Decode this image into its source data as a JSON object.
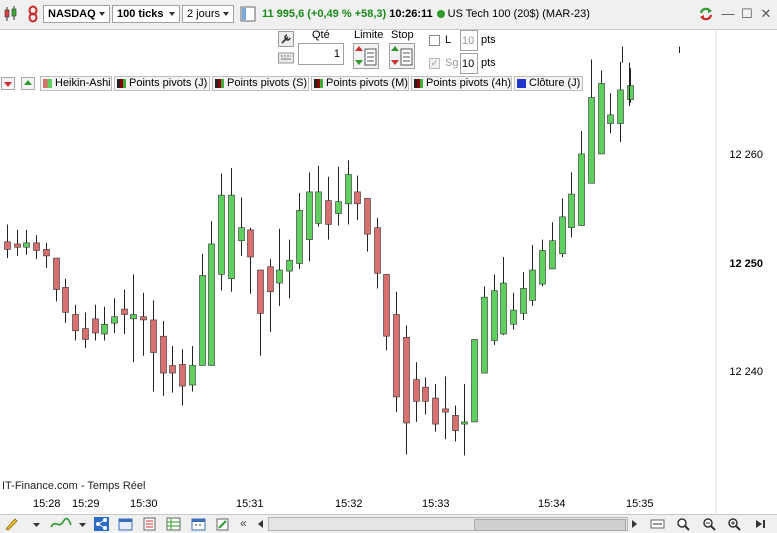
{
  "toolbar": {
    "instrument": "NASDAQ",
    "ticks": "100 ticks",
    "period": "2 jours",
    "price": "11 995,6",
    "change": "(+0,49 % +58,3)",
    "time": "10:26:11",
    "contract": "US Tech 100 (20$) (MAR-23)"
  },
  "order": {
    "qty_label": "Qté",
    "qty_value": "1",
    "limit_label": "Limite",
    "stop_label": "Stop",
    "l_label": "L",
    "sg_label": "Sg",
    "pts1_value": "10",
    "pts1_label": "pts",
    "pts2_value": "10",
    "pts2_label": "pts"
  },
  "indicators": [
    {
      "label": "Heikin-Ashi",
      "color": "#c0504d"
    },
    {
      "label": "Points pivots (J)",
      "color": "#8b0000"
    },
    {
      "label": "Points pivots (S)",
      "color": "#8b0000"
    },
    {
      "label": "Points pivots (M)",
      "color": "#8b0000"
    },
    {
      "label": "Points pivots (4h)",
      "color": "#8b0000"
    },
    {
      "label": "Clôture (J)",
      "color": "#2233cc"
    }
  ],
  "price_axis": {
    "p12260": "12 260",
    "p12250": "12 250",
    "p12240": "12 240"
  },
  "time_axis": {
    "t1": "15:28",
    "t2": "15:29",
    "t3": "15:30",
    "t4": "15:31",
    "t5": "15:32",
    "t6": "15:33",
    "t7": "15:34",
    "t8": "15:35"
  },
  "watermark": "IT-Finance.com - Temps Réel",
  "colors": {
    "up": "#5fcf5f",
    "down": "#d97070",
    "wick": "#222222"
  },
  "chart_data": {
    "type": "candlestick",
    "ylim": [
      12232,
      12270
    ],
    "candles": [
      {
        "o": 12252.0,
        "c": 12251.3,
        "h": 12253.6,
        "l": 12250.5
      },
      {
        "o": 12251.8,
        "c": 12251.5,
        "h": 12253.1,
        "l": 12250.7
      },
      {
        "o": 12251.5,
        "c": 12251.9,
        "h": 12253.1,
        "l": 12250.8
      },
      {
        "o": 12251.9,
        "c": 12251.2,
        "h": 12252.6,
        "l": 12250.4
      },
      {
        "o": 12251.3,
        "c": 12250.7,
        "h": 12251.9,
        "l": 12249.6
      },
      {
        "o": 12250.5,
        "c": 12247.6,
        "h": 12250.5,
        "l": 12246.5
      },
      {
        "o": 12247.8,
        "c": 12245.5,
        "h": 12248.6,
        "l": 12244.5
      },
      {
        "o": 12245.3,
        "c": 12243.8,
        "h": 12246.2,
        "l": 12242.9
      },
      {
        "o": 12244.0,
        "c": 12243.0,
        "h": 12245.5,
        "l": 12242.2
      },
      {
        "o": 12244.9,
        "c": 12243.6,
        "h": 12246.2,
        "l": 12242.9
      },
      {
        "o": 12243.5,
        "c": 12244.4,
        "h": 12246.0,
        "l": 12242.9
      },
      {
        "o": 12244.5,
        "c": 12245.1,
        "h": 12246.8,
        "l": 12243.6
      },
      {
        "o": 12245.8,
        "c": 12245.3,
        "h": 12247.6,
        "l": 12243.5
      },
      {
        "o": 12244.9,
        "c": 12245.3,
        "h": 12249.0,
        "l": 12240.9
      },
      {
        "o": 12245.1,
        "c": 12244.8,
        "h": 12247.3,
        "l": 12241.5
      },
      {
        "o": 12244.8,
        "c": 12241.8,
        "h": 12246.6,
        "l": 12238.2
      },
      {
        "o": 12243.3,
        "c": 12239.9,
        "h": 12244.7,
        "l": 12237.8
      },
      {
        "o": 12240.6,
        "c": 12239.9,
        "h": 12242.4,
        "l": 12238.1
      },
      {
        "o": 12240.7,
        "c": 12238.7,
        "h": 12242.1,
        "l": 12236.9
      },
      {
        "o": 12238.8,
        "c": 12240.6,
        "h": 12242.4,
        "l": 12238.2
      },
      {
        "o": 12240.6,
        "c": 12248.9,
        "h": 12250.9,
        "l": 12240.6
      },
      {
        "o": 12240.6,
        "c": 12251.8,
        "h": 12253.9,
        "l": 12240.6
      },
      {
        "o": 12249.0,
        "c": 12256.3,
        "h": 12258.3,
        "l": 12247.5
      },
      {
        "o": 12248.6,
        "c": 12256.3,
        "h": 12258.8,
        "l": 12247.4
      },
      {
        "o": 12252.1,
        "c": 12253.3,
        "h": 12256.1,
        "l": 12250.7
      },
      {
        "o": 12253.1,
        "c": 12250.6,
        "h": 12253.3,
        "l": 12247.2
      },
      {
        "o": 12249.4,
        "c": 12245.4,
        "h": 12249.4,
        "l": 12241.5
      },
      {
        "o": 12249.7,
        "c": 12247.4,
        "h": 12250.4,
        "l": 12243.7
      },
      {
        "o": 12248.2,
        "c": 12249.4,
        "h": 12253.2,
        "l": 12246.1
      },
      {
        "o": 12249.3,
        "c": 12250.3,
        "h": 12252.2,
        "l": 12246.8
      },
      {
        "o": 12250.0,
        "c": 12254.9,
        "h": 12256.5,
        "l": 12249.5
      },
      {
        "o": 12252.2,
        "c": 12256.6,
        "h": 12258.4,
        "l": 12250.2
      },
      {
        "o": 12253.7,
        "c": 12256.6,
        "h": 12259.0,
        "l": 12253.4
      },
      {
        "o": 12255.8,
        "c": 12253.6,
        "h": 12258.0,
        "l": 12252.2
      },
      {
        "o": 12254.6,
        "c": 12255.7,
        "h": 12258.9,
        "l": 12253.5
      },
      {
        "o": 12255.5,
        "c": 12258.2,
        "h": 12259.5,
        "l": 12253.6
      },
      {
        "o": 12256.6,
        "c": 12255.5,
        "h": 12258.1,
        "l": 12254.0
      },
      {
        "o": 12256.0,
        "c": 12252.7,
        "h": 12256.0,
        "l": 12251.1
      },
      {
        "o": 12253.3,
        "c": 12249.1,
        "h": 12254.2,
        "l": 12247.7
      },
      {
        "o": 12249.0,
        "c": 12243.3,
        "h": 12249.0,
        "l": 12242.0
      },
      {
        "o": 12245.3,
        "c": 12237.7,
        "h": 12247.4,
        "l": 12236.3
      },
      {
        "o": 12243.2,
        "c": 12235.3,
        "h": 12244.3,
        "l": 12232.4
      },
      {
        "o": 12239.3,
        "c": 12237.3,
        "h": 12240.9,
        "l": 12235.4
      },
      {
        "o": 12238.6,
        "c": 12237.3,
        "h": 12239.5,
        "l": 12236.1
      },
      {
        "o": 12237.6,
        "c": 12235.2,
        "h": 12238.9,
        "l": 12234.5
      },
      {
        "o": 12236.6,
        "c": 12236.3,
        "h": 12239.6,
        "l": 12233.8
      },
      {
        "o": 12236.0,
        "c": 12234.6,
        "h": 12236.9,
        "l": 12233.6
      },
      {
        "o": 12235.2,
        "c": 12235.4,
        "h": 12238.9,
        "l": 12232.3
      },
      {
        "o": 12235.4,
        "c": 12243.0,
        "h": 12243.0,
        "l": 12235.4
      },
      {
        "o": 12239.9,
        "c": 12246.9,
        "h": 12247.9,
        "l": 12239.9
      },
      {
        "o": 12242.9,
        "c": 12247.5,
        "h": 12249.0,
        "l": 12242.5
      },
      {
        "o": 12243.5,
        "c": 12248.2,
        "h": 12250.6,
        "l": 12243.4
      },
      {
        "o": 12244.4,
        "c": 12245.7,
        "h": 12247.3,
        "l": 12243.9
      },
      {
        "o": 12245.4,
        "c": 12247.7,
        "h": 12249.2,
        "l": 12244.8
      },
      {
        "o": 12246.6,
        "c": 12249.4,
        "h": 12251.7,
        "l": 12246.1
      },
      {
        "o": 12248.1,
        "c": 12251.2,
        "h": 12252.2,
        "l": 12247.9
      },
      {
        "o": 12249.5,
        "c": 12252.1,
        "h": 12253.8,
        "l": 12249.5
      },
      {
        "o": 12250.9,
        "c": 12254.3,
        "h": 12256.0,
        "l": 12250.6
      },
      {
        "o": 12253.3,
        "c": 12256.4,
        "h": 12258.4,
        "l": 12252.4
      },
      {
        "o": 12253.5,
        "c": 12260.1,
        "h": 12262.2,
        "l": 12253.5
      },
      {
        "o": 12257.4,
        "c": 12265.3,
        "h": 12268.8,
        "l": 12257.4
      },
      {
        "o": 12260.1,
        "c": 12266.6,
        "h": 12267.8,
        "l": 12260.1
      },
      {
        "o": 12262.9,
        "c": 12263.7,
        "h": 12265.7,
        "l": 12262.0
      },
      {
        "o": 12262.9,
        "c": 12266.0,
        "h": 12268.6,
        "l": 12261.2
      },
      {
        "o": 12265.1,
        "c": 12266.4,
        "h": 12268.0,
        "l": 12264.8
      }
    ]
  }
}
